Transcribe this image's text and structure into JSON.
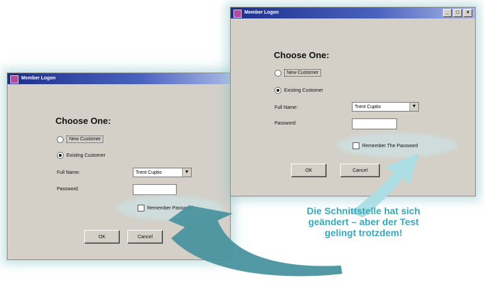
{
  "window_left": {
    "title": "Member Logon",
    "heading": "Choose One:",
    "radio_new": "New Customer",
    "radio_existing": "Existing Customer",
    "full_name_label": "Full Name:",
    "full_name_value": "Trent Cuptio",
    "password_label": "Password",
    "remember_label": "Remember Password",
    "ok_label": "OK",
    "cancel_label": "Cancel"
  },
  "window_right": {
    "title": "Member Logon",
    "heading": "Choose One:",
    "radio_new": "New Customer",
    "radio_existing": "Existing Customer",
    "full_name_label": "Full Name:",
    "full_name_value": "Trent Cuptio",
    "password_label": "Password",
    "remember_label": "Remember The Password",
    "ok_label": "OK",
    "cancel_label": "Cancel"
  },
  "caption": {
    "line1": "Die Schnittstelle hat sich",
    "line2": "geändert – aber der Test",
    "line3": "gelingt trotzdem!"
  },
  "colors": {
    "caption": "#3aa8b8",
    "arrow_teal": "#4a93a0",
    "arrow_light": "#a9dde4",
    "window_bg": "#d4d0c8",
    "titlebar": "#1d2f8c"
  },
  "icons": {
    "radio_selected": "radio-selected-icon",
    "dropdown": "chevron-down-icon"
  }
}
